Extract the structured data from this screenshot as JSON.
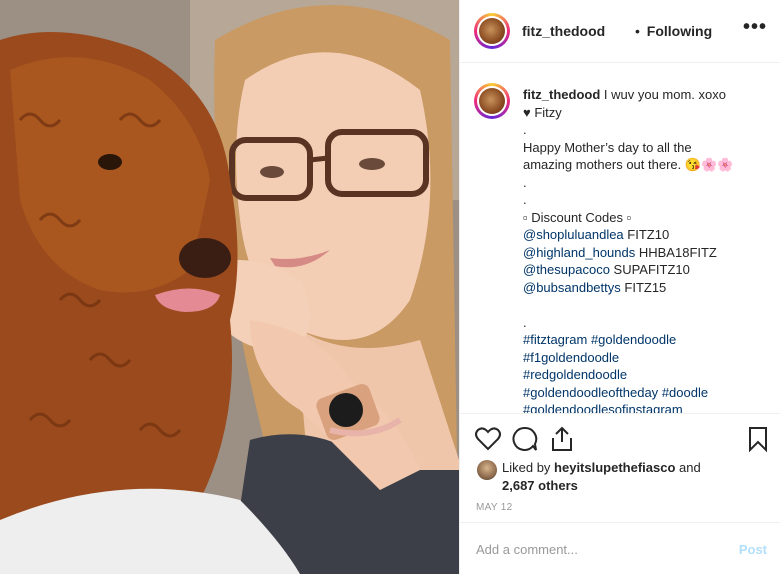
{
  "header": {
    "username": "fitz_thedood",
    "separator": "•",
    "follow_status": "Following",
    "more_icon": "more-horizontal-icon"
  },
  "caption": {
    "username": "fitz_thedood",
    "text_lines": [
      "I wuv you mom. xoxo",
      "♥ Fitzy",
      ".",
      "Happy Mother’s day to all the",
      "amazing mothers out there. 😘🌸🌸",
      ".",
      ".",
      "▫ Discount Codes ▫"
    ],
    "codes": [
      {
        "tag": "@shopluluandlea",
        "code": "FITZ10"
      },
      {
        "tag": "@highland_hounds",
        "code": "HHBA18FITZ"
      },
      {
        "tag": "@thesupacoco",
        "code": "SUPAFITZ10"
      },
      {
        "tag": "@bubsandbettys",
        "code": "FITZ15"
      }
    ],
    "dots_after_codes": [
      "",
      "."
    ],
    "hashtag_lines": [
      [
        "#fitztagram",
        "#goldendoodle"
      ],
      [
        "#f1goldendoodle"
      ],
      [
        "#redgoldendoodle"
      ],
      [
        "#goldendoodleoftheday",
        "#doodle"
      ],
      [
        "#goldendoodlesofinstagram"
      ]
    ]
  },
  "actions": {
    "like_icon": "heart-icon",
    "comment_icon": "comment-icon",
    "share_icon": "share-icon",
    "save_icon": "bookmark-icon"
  },
  "likes": {
    "prefix": "Liked by",
    "user": "heyitslupethefiasco",
    "joiner": "and",
    "others": "2,687 others"
  },
  "date": "MAY 12",
  "comment": {
    "placeholder": "Add a comment...",
    "post_label": "Post"
  },
  "colors": {
    "link": "#003569",
    "post_disabled": "#b2dffc",
    "muted": "#999999",
    "text": "#262626"
  }
}
